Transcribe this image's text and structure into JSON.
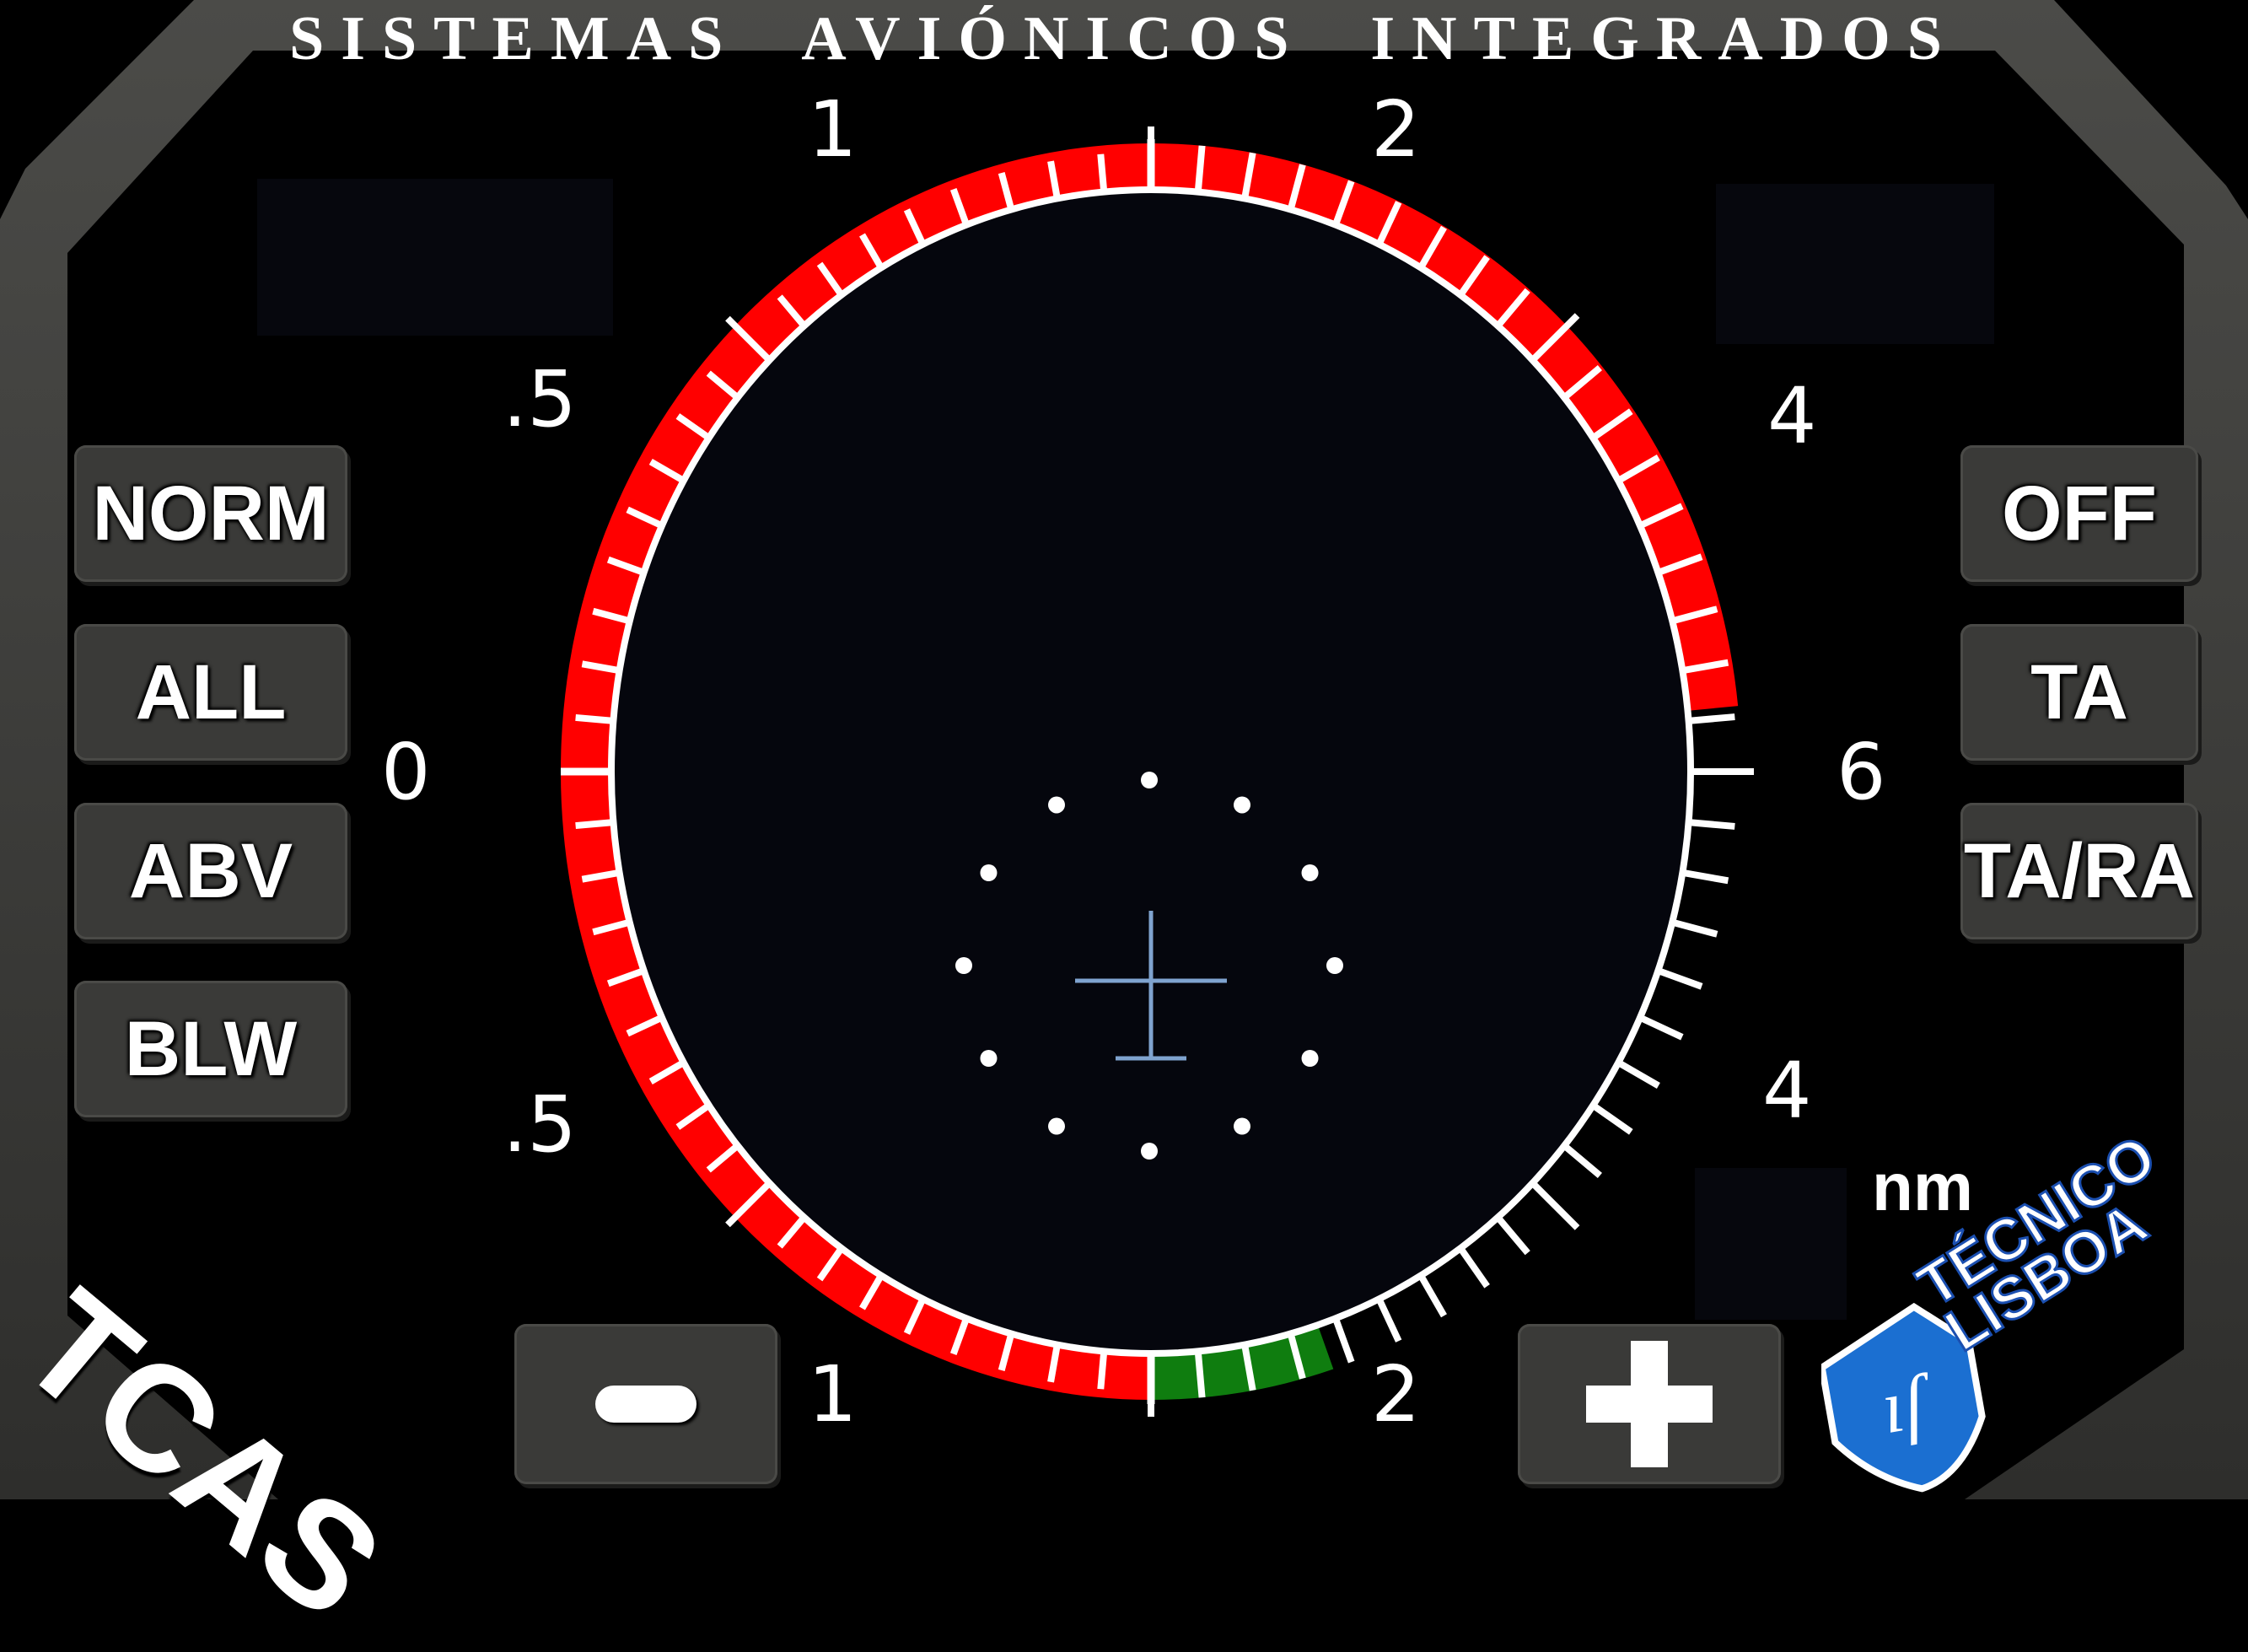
{
  "title": "SISTEMAS  AVIÓNICOS  INTEGRADOS",
  "mode_buttons_left": [
    {
      "label": "NORM"
    },
    {
      "label": "ALL"
    },
    {
      "label": "ABV"
    },
    {
      "label": "BLW"
    }
  ],
  "mode_buttons_right": [
    {
      "label": "OFF"
    },
    {
      "label": "TA"
    },
    {
      "label": "TA/RA"
    }
  ],
  "zoom": {
    "minus": "−",
    "plus": "+"
  },
  "left_scale": {
    "top_1": "1",
    "top_05": ".5",
    "zero": "0",
    "bottom_05": ".5",
    "bottom_1": "1"
  },
  "right_scale": {
    "top_2": "2",
    "top_4": "4",
    "six": "6",
    "bottom_4": "4",
    "bottom_2": "2"
  },
  "unit": "nm",
  "system_label": "TCAS",
  "logo": {
    "line1": "TÉCNICO",
    "line2": "LISBOA"
  },
  "colors": {
    "arc_red": "#ff0000",
    "indicator_green": "#0f7d0f",
    "aircraft": "#7fa3cf",
    "screen": "#05060d"
  },
  "indicators": {
    "left_red_arc_fraction": 1.0,
    "right_top_red_span": [
      2,
      6
    ],
    "right_bottom_green_span": [
      1.5,
      2
    ]
  }
}
